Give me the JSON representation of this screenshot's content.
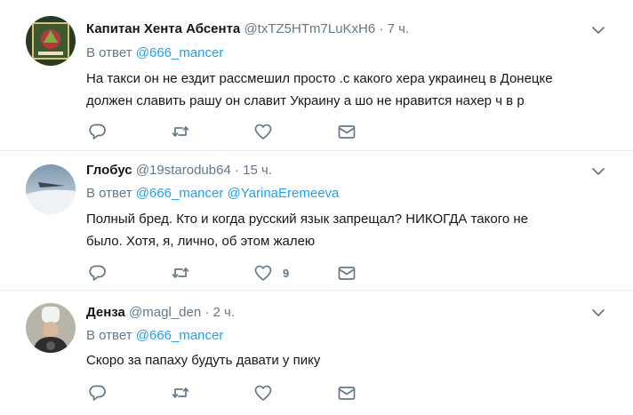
{
  "tweets": [
    {
      "name": "Капитан Хента Абсента",
      "handle": "@txTZ5HTm7LuKxH6",
      "dot": "·",
      "time": "7 ч.",
      "replying_prefix": "В ответ",
      "mentions": [
        "@666_mancer"
      ],
      "lines": [
        "На такси он не ездит рассмешил просто .с какого хера украинец в Донецке",
        "должен славить рашу он славит Украину а шо не нравится нахер ч в р"
      ],
      "likes": ""
    },
    {
      "name": "Глобус",
      "handle": "@19starodub64",
      "dot": "·",
      "time": "15 ч.",
      "replying_prefix": "В ответ",
      "mentions": [
        "@666_mancer",
        "@YarinaEremeeva"
      ],
      "lines": [
        "Полный бред. Кто и когда русский язык запрещал? НИКОГДА такого не",
        "было. Хотя, я, лично, об этом жалею"
      ],
      "likes": "9"
    },
    {
      "name": "Денза",
      "handle": "@magl_den",
      "dot": "·",
      "time": "2 ч.",
      "replying_prefix": "В ответ",
      "mentions": [
        "@666_mancer"
      ],
      "lines": [
        "Скоро за папаху будуть давати у пику"
      ],
      "likes": ""
    }
  ],
  "icons": {
    "reply": "reply-icon",
    "retweet": "retweet-icon",
    "like": "heart-icon",
    "dm": "envelope-icon",
    "caret": "chevron-down-icon"
  },
  "colors": {
    "text": "#14171a",
    "secondary": "#657786",
    "link": "#1da1f2",
    "divider": "#e6ecf0"
  }
}
